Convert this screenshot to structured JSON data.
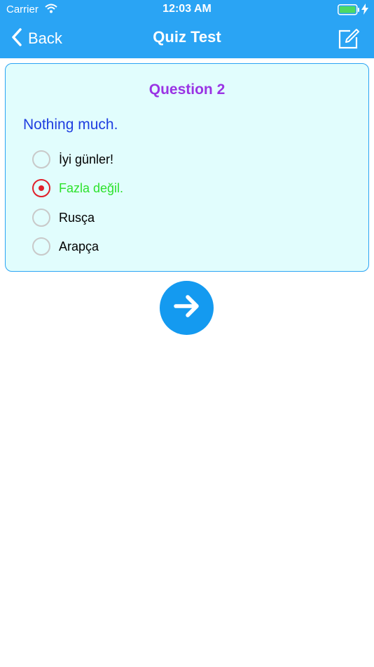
{
  "status_bar": {
    "carrier": "Carrier",
    "time": "12:03 AM"
  },
  "nav": {
    "back_label": "Back",
    "title": "Quiz Test"
  },
  "quiz": {
    "question_title": "Question 2",
    "prompt": "Nothing much.",
    "options": [
      {
        "label": "İyi günler!",
        "selected": false
      },
      {
        "label": "Fazla değil.",
        "selected": true
      },
      {
        "label": "Rusça",
        "selected": false
      },
      {
        "label": "Arapça",
        "selected": false
      }
    ]
  },
  "colors": {
    "nav_bar": "#2aa4f4",
    "card_bg": "#e1fdfd",
    "question_title": "#9a34e4",
    "prompt": "#1f3ee0",
    "selected_radio": "#e0202a",
    "selected_text": "#2de22d",
    "next_button": "#149af0"
  },
  "icons": [
    "wifi-icon",
    "battery-icon",
    "charging-bolt-icon",
    "back-chevron-icon",
    "edit-note-icon",
    "arrow-right-icon"
  ]
}
